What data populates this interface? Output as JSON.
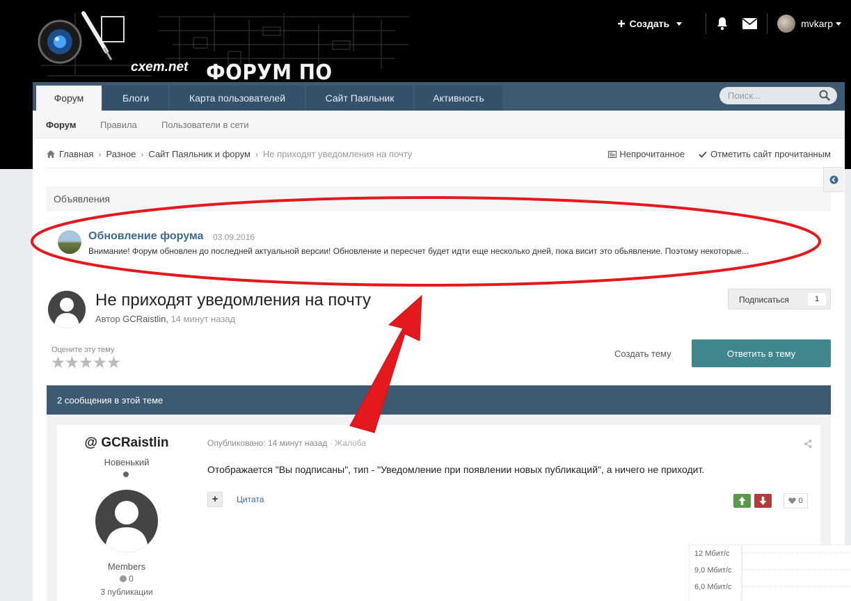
{
  "header": {
    "site_name": "cxem.net",
    "logo_title": "ФОРУМ ПО ЭЛЕКТРОНИКЕ",
    "create_label": "Создать",
    "username": "mvkarp"
  },
  "main_nav": {
    "tabs": [
      {
        "label": "Форум",
        "active": true
      },
      {
        "label": "Блоги",
        "active": false
      },
      {
        "label": "Карта пользователей",
        "active": false
      },
      {
        "label": "Сайт Паяльник",
        "active": false
      },
      {
        "label": "Активность",
        "active": false
      }
    ],
    "search_placeholder": "Поиск..."
  },
  "sub_nav": {
    "items": [
      {
        "label": "Форум",
        "active": true
      },
      {
        "label": "Правила",
        "active": false
      },
      {
        "label": "Пользователи в сети",
        "active": false
      }
    ]
  },
  "breadcrumb": {
    "items": [
      "Главная",
      "Разное",
      "Сайт Паяльник и форум",
      "Не приходят уведомления на почту"
    ],
    "unread": "Непрочитанное",
    "mark_read": "Отметить сайт прочитанным"
  },
  "announcements": {
    "heading": "Объявления",
    "title": "Обновление форума",
    "date": "03.09.2016",
    "text": "Внимание! Форум обновлен до последней актуальной версии! Обновление и пересчет будет идти еще несколько дней, пока висит это обьявление. Поэтому некоторые..."
  },
  "topic": {
    "title": "Не приходят уведомления на почту",
    "author_prefix": "Автор",
    "author": "GCRaistlin",
    "time": "14 минут назад",
    "subscribe_label": "Подписаться",
    "subscribe_count": "1",
    "rate_label": "Оцените эту тему",
    "rating": 0,
    "create_topic": "Создать тему",
    "reply": "Ответить в тему",
    "posts_count_label": "2 сообщения в этой теме"
  },
  "post": {
    "author_name": "@ GCRaistlin",
    "author_rank": "Новенький",
    "author_group": "Members",
    "reputation": "0",
    "posts": "3 публикации",
    "published_label": "Опубликовано:",
    "published_time": "14 минут назад",
    "report": "Жалоба",
    "body": "Отображается \"Вы подписаны\", тип - \"Уведомление при появлении новых публикаций\", а ничего не приходит.",
    "quote": "Цитата",
    "likes": "0"
  },
  "speed_widget": {
    "labels": [
      "12 Мбит/с",
      "9,0 Мбит/с",
      "6,0 Мбит/с"
    ]
  },
  "colors": {
    "nav": "#3d5a72",
    "accent": "#3f878c",
    "link": "#3d6a8f",
    "annotation": "#e3191e"
  }
}
